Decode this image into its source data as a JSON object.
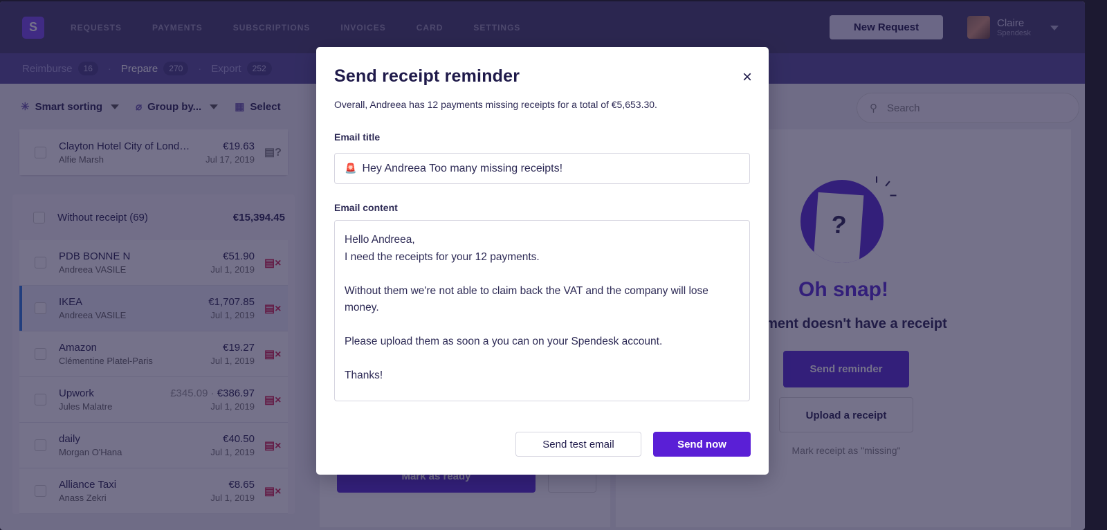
{
  "nav": {
    "logo": "S",
    "items": [
      "REQUESTS",
      "PAYMENTS",
      "SUBSCRIPTIONS",
      "INVOICES",
      "CARD",
      "SETTINGS"
    ],
    "new_request": "New Request",
    "user": {
      "name": "Claire",
      "org": "Spendesk"
    }
  },
  "subnav": [
    {
      "label": "Reimburse",
      "count": "16"
    },
    {
      "label": "Prepare",
      "count": "270"
    },
    {
      "label": "Export",
      "count": "252"
    }
  ],
  "toolbar": {
    "smart_sorting": "Smart sorting",
    "group_by": "Group by...",
    "select": "Select",
    "search_placeholder": "Search"
  },
  "list": {
    "top_row": {
      "name": "Clayton Hotel City of London",
      "sub": "Alfie Marsh",
      "amount": "€19.63",
      "date": "Jul 17, 2019"
    },
    "group": {
      "label": "Without receipt (69)",
      "total": "€15,394.45"
    },
    "rows": [
      {
        "name": "PDB BONNE N",
        "sub": "Andreea VASILE",
        "orig": "",
        "amount": "€51.90",
        "date": "Jul 1, 2019"
      },
      {
        "name": "IKEA",
        "sub": "Andreea VASILE",
        "orig": "",
        "amount": "€1,707.85",
        "date": "Jul 1, 2019"
      },
      {
        "name": "Amazon",
        "sub": "Clémentine Platel-Paris",
        "orig": "",
        "amount": "€19.27",
        "date": "Jul 1, 2019"
      },
      {
        "name": "Upwork",
        "sub": "Jules Malatre",
        "orig": "£345.09 · ",
        "amount": "€386.97",
        "date": "Jul 1, 2019"
      },
      {
        "name": "daily",
        "sub": "Morgan O'Hana",
        "orig": "",
        "amount": "€40.50",
        "date": "Jul 1, 2019"
      },
      {
        "name": "Alliance Taxi",
        "sub": "Anass Zekri",
        "orig": "",
        "amount": "€8.65",
        "date": "Jul 1, 2019"
      }
    ]
  },
  "middle": {
    "mark_ready": "Mark as ready"
  },
  "detail": {
    "title": "Oh snap!",
    "subtitle": "This payment doesn't have a receipt",
    "send_reminder": "Send reminder",
    "upload": "Upload a receipt",
    "mark_missing": "Mark receipt as \"missing\"",
    "receipt_glyph": "?"
  },
  "modal": {
    "title": "Send receipt reminder",
    "summary": "Overall, Andreea has 12 payments missing receipts for a total of €5,653.30.",
    "email_title_label": "Email title",
    "email_title_value": "Hey Andreea Too many missing receipts!",
    "email_title_emoji": "🚨",
    "email_content_label": "Email content",
    "email_content_value": "Hello Andreea,\nI need the receipts for your 12 payments.\n\nWithout them we're not able to claim back the VAT and the company will lose money.\n\nPlease upload them as soon a you can on your Spendesk account.\n\nThanks!",
    "send_test": "Send test email",
    "send_now": "Send now",
    "close": "×"
  },
  "colors": {
    "accent": "#5a1fd6",
    "overlay": "rgba(25,20,60,0.6)",
    "missing_receipt": "#d32a55"
  }
}
